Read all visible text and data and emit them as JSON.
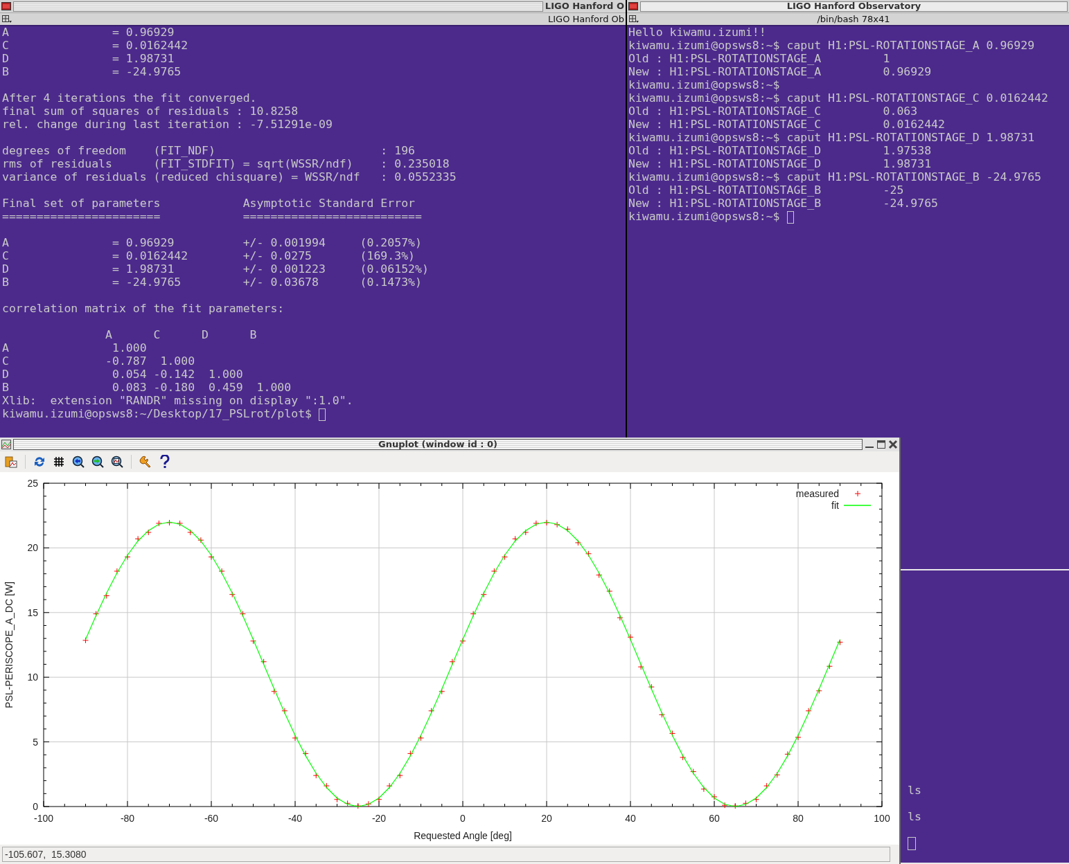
{
  "terminals": [
    {
      "title": "LIGO Hanford O",
      "subtitle": "LIGO Hanford Ob",
      "paragraphs": [
        [
          "A               = 0.96929",
          "C               = 0.0162442",
          "D               = 1.98731",
          "B               = -24.9765"
        ],
        [
          "After 4 iterations the fit converged.",
          "final sum of squares of residuals : 10.8258",
          "rel. change during last iteration : -7.51291e-09"
        ],
        [
          "degrees of freedom    (FIT_NDF)                        : 196",
          "rms of residuals      (FIT_STDFIT) = sqrt(WSSR/ndf)    : 0.235018",
          "variance of residuals (reduced chisquare) = WSSR/ndf   : 0.0552335"
        ],
        [
          "Final set of parameters            Asymptotic Standard Error",
          "=======================            =========================="
        ],
        [
          "A               = 0.96929          +/- 0.001994     (0.2057%)",
          "C               = 0.0162442        +/- 0.0275       (169.3%)",
          "D               = 1.98731          +/- 0.001223     (0.06152%)",
          "B               = -24.9765         +/- 0.03678      (0.1473%)"
        ],
        [
          "correlation matrix of the fit parameters:"
        ],
        [
          "               A      C      D      B",
          "A               1.000",
          "C              -0.787  1.000",
          "D               0.054 -0.142  1.000",
          "B               0.083 -0.180  0.459  1.000",
          "Xlib:  extension \"RANDR\" missing on display \":1.0\".",
          "kiwamu.izumi@opsws8:~/Desktop/17_PSLrot/plot$"
        ]
      ]
    },
    {
      "title": "LIGO Hanford Observatory",
      "subtitle": "/bin/bash 78x41",
      "paragraphs": [
        [
          "Hello kiwamu.izumi!!",
          "kiwamu.izumi@opsws8:~$ caput H1:PSL-ROTATIONSTAGE_A 0.96929",
          "Old : H1:PSL-ROTATIONSTAGE_A         1",
          "New : H1:PSL-ROTATIONSTAGE_A         0.96929",
          "kiwamu.izumi@opsws8:~$",
          "kiwamu.izumi@opsws8:~$ caput H1:PSL-ROTATIONSTAGE_C 0.0162442",
          "Old : H1:PSL-ROTATIONSTAGE_C         0.063",
          "New : H1:PSL-ROTATIONSTAGE_C         0.0162442",
          "kiwamu.izumi@opsws8:~$ caput H1:PSL-ROTATIONSTAGE_D 1.98731",
          "Old : H1:PSL-ROTATIONSTAGE_D         1.97538",
          "New : H1:PSL-ROTATIONSTAGE_D         1.98731",
          "kiwamu.izumi@opsws8:~$ caput H1:PSL-ROTATIONSTAGE_B -24.9765",
          "Old : H1:PSL-ROTATIONSTAGE_B         -25",
          "New : H1:PSL-ROTATIONSTAGE_B         -24.9765",
          "kiwamu.izumi@opsws8:~$"
        ]
      ]
    }
  ],
  "lower_terminal": {
    "paragraphs": [
      [
        "ls"
      ],
      [
        "ls"
      ]
    ]
  },
  "gnuplot": {
    "title": "Gnuplot (window id : 0)",
    "status": "-105.607,  15.3080",
    "chart_data": {
      "type": "scatter",
      "xlabel": "Requested Angle [deg]",
      "ylabel": "PSL-PERISCOPE_A_DC [W]",
      "xlim": [
        -100,
        100
      ],
      "ylim": [
        0,
        25
      ],
      "xticks": [
        -100,
        -80,
        -60,
        -40,
        -20,
        0,
        20,
        40,
        60,
        80,
        100
      ],
      "yticks": [
        0,
        5,
        10,
        15,
        20,
        25
      ],
      "grid": true,
      "legend": true,
      "x": [
        -90,
        -87.5,
        -85,
        -82.5,
        -80,
        -77.5,
        -75,
        -72.5,
        -70,
        -67.5,
        -65,
        -62.5,
        -60,
        -57.5,
        -55,
        -52.5,
        -50,
        -47.5,
        -45,
        -42.5,
        -40,
        -37.5,
        -35,
        -32.5,
        -30,
        -27.5,
        -25,
        -22.5,
        -20,
        -17.5,
        -15,
        -12.5,
        -10,
        -7.5,
        -5,
        -2.5,
        0,
        2.5,
        5,
        7.5,
        10,
        12.5,
        15,
        17.5,
        20,
        22.5,
        25,
        27.5,
        30,
        32.5,
        35,
        37.5,
        40,
        42.5,
        45,
        47.5,
        50,
        52.5,
        55,
        57.5,
        60,
        62.5,
        65,
        67.5,
        70,
        72.5,
        75,
        77.5,
        80,
        82.5,
        85,
        87.5,
        90
      ],
      "series": [
        {
          "name": "measured",
          "color": "#ff0000",
          "values": [
            12.85,
            14.9,
            16.3,
            18.2,
            19.3,
            20.7,
            21.2,
            21.9,
            21.95,
            21.9,
            21.2,
            20.6,
            19.3,
            18.2,
            16.4,
            14.9,
            12.8,
            11.2,
            8.9,
            7.4,
            5.3,
            4.1,
            2.4,
            1.6,
            0.55,
            0.25,
            0.05,
            0.2,
            0.55,
            1.6,
            2.4,
            4.1,
            5.3,
            7.4,
            8.9,
            11.2,
            12.8,
            14.9,
            16.4,
            18.2,
            19.3,
            20.7,
            21.2,
            21.9,
            21.95,
            21.8,
            21.45,
            20.4,
            19.55,
            17.9,
            16.65,
            14.6,
            13.1,
            10.8,
            9.25,
            7.1,
            5.65,
            3.8,
            2.7,
            1.35,
            0.75,
            0.1,
            0.05,
            0.25,
            0.55,
            1.6,
            2.45,
            4.05,
            5.35,
            7.4,
            8.95,
            10.85,
            12.7
          ]
        },
        {
          "name": "fit",
          "color": "#00ff00",
          "type": "line",
          "values": [
            12.91,
            14.76,
            16.5,
            18.07,
            19.43,
            20.53,
            21.34,
            21.83,
            22,
            21.83,
            21.34,
            20.53,
            19.43,
            18.07,
            16.5,
            14.76,
            12.91,
            11,
            9.09,
            7.24,
            5.5,
            3.93,
            2.57,
            1.47,
            0.66,
            0.17,
            0,
            0.17,
            0.66,
            1.47,
            2.57,
            3.93,
            5.5,
            7.24,
            9.09,
            11,
            12.91,
            14.76,
            16.5,
            18.07,
            19.43,
            20.53,
            21.34,
            21.83,
            22,
            21.83,
            21.34,
            20.53,
            19.43,
            18.07,
            16.5,
            14.76,
            12.91,
            11,
            9.09,
            7.24,
            5.5,
            3.93,
            2.57,
            1.47,
            0.66,
            0.17,
            0,
            0.17,
            0.66,
            1.47,
            2.57,
            3.93,
            5.5,
            7.24,
            9.09,
            11,
            12.91
          ]
        }
      ]
    }
  }
}
